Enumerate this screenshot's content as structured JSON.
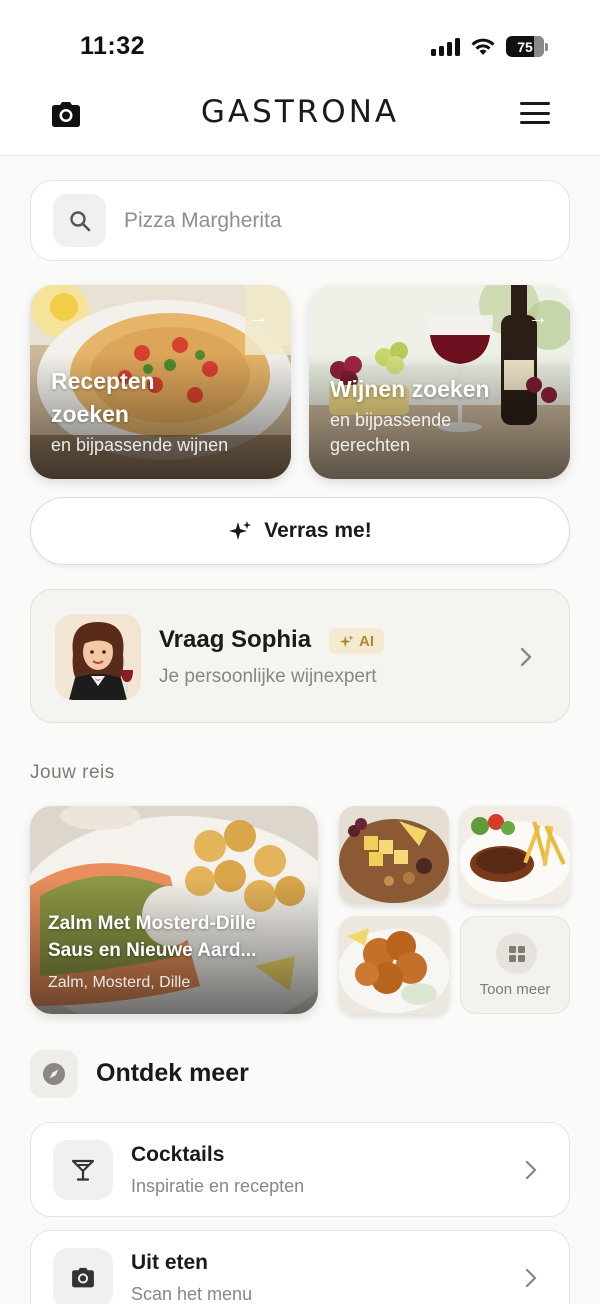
{
  "status_bar": {
    "time": "11:32",
    "battery": "75"
  },
  "header": {
    "brand": "GASTRONA",
    "camera_icon": "camera-icon",
    "menu_icon": "hamburger-menu-icon"
  },
  "search": {
    "placeholder": "Pizza Margherita",
    "icon": "search-icon"
  },
  "feature_cards": [
    {
      "title_line1": "Recepten",
      "title_line2": "zoeken",
      "subtitle": "en bijpassende wijnen",
      "icon": "arrow-right-icon"
    },
    {
      "title_line1": "Wijnen zoeken",
      "subtitle_line1": "en bijpassende",
      "subtitle_line2": "gerechten",
      "icon": "arrow-right-icon"
    }
  ],
  "surprise": {
    "label": "Verras me!",
    "icon": "sparkles-icon"
  },
  "sophia": {
    "title": "Vraag Sophia",
    "badge": "AI",
    "subtitle": "Je persoonlijke wijnexpert",
    "icon": "chevron-right-icon"
  },
  "journey": {
    "label": "Jouw reis",
    "main": {
      "title_line1": "Zalm Met Mosterd-Dille",
      "title_line2": "Saus en Nieuwe Aard...",
      "subtitle": "Zalm, Mosterd, Dille"
    },
    "more_label": "Toon meer",
    "more_icon": "grid-icon"
  },
  "explore": {
    "title": "Ontdek meer",
    "icon": "compass-icon",
    "items": [
      {
        "title": "Cocktails",
        "subtitle": "Inspiratie en recepten",
        "icon": "cocktail-glass-icon"
      },
      {
        "title": "Uit eten",
        "subtitle": "Scan het menu",
        "icon": "camera-icon"
      }
    ]
  },
  "colors": {
    "background": "#fafaf9",
    "accent_gold": "#b08a2e",
    "text_primary": "#1a1a1a",
    "text_secondary": "#8a8782"
  }
}
